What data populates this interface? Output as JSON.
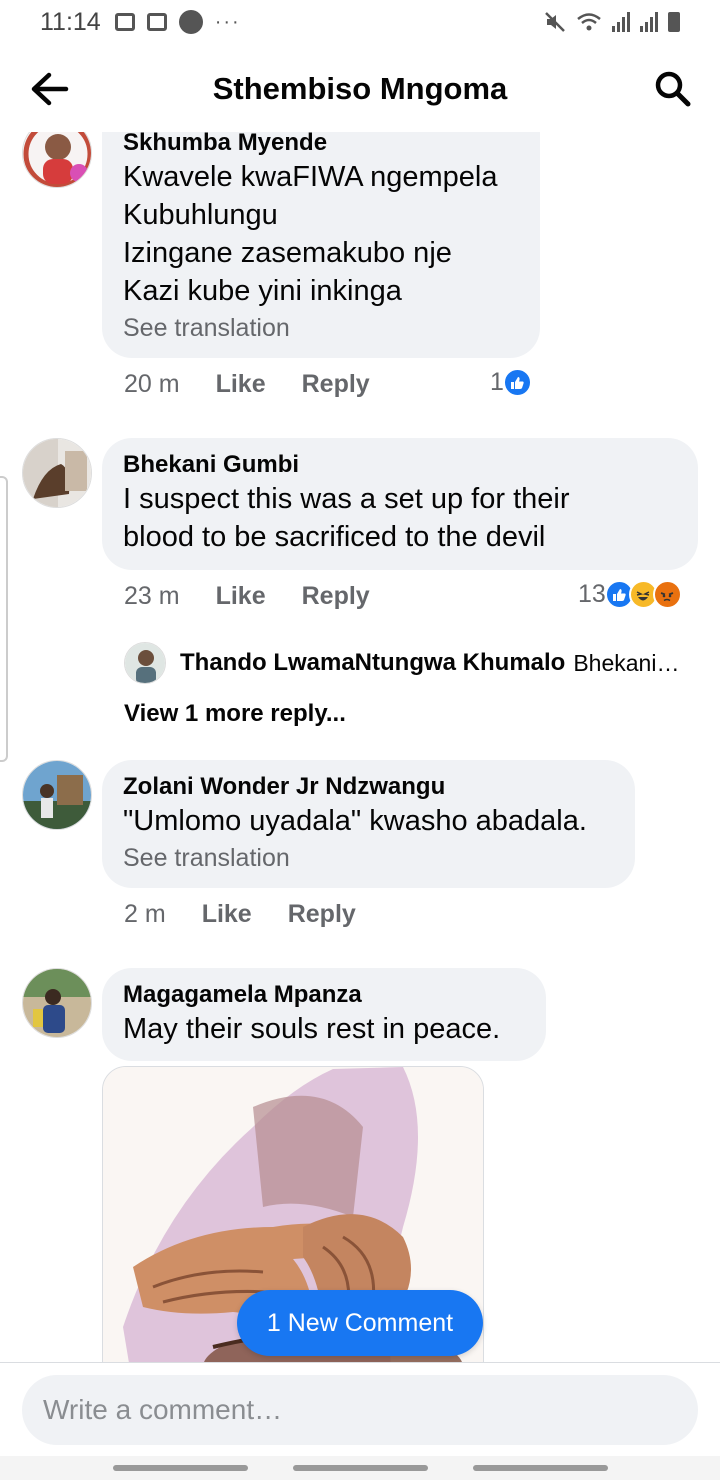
{
  "status_bar": {
    "time": "11:14",
    "more": "···"
  },
  "header": {
    "title": "Sthembiso Mngoma"
  },
  "comments": [
    {
      "name": "Skhumba Myende",
      "lines": [
        "Kwavele kwaFIWA ngempela",
        "Kubuhlungu",
        "Izingane zasemakubo nje",
        "Kazi kube yini inkinga"
      ],
      "see_translation": "See translation",
      "time": "20 m",
      "like": "Like",
      "reply": "Reply",
      "reaction_count": "1"
    },
    {
      "name": "Bhekani Gumbi",
      "lines": [
        "I suspect this was a set up for their",
        "blood to be sacrificed to the devil"
      ],
      "time": "23 m",
      "like": "Like",
      "reply": "Reply",
      "reaction_count": "13",
      "reply_preview": {
        "name": "Thando LwamaNtungwa Khumalo",
        "snippet": "Bhekani…"
      },
      "view_more": "View 1 more reply..."
    },
    {
      "name": "Zolani Wonder Jr Ndzwangu",
      "lines": [
        "\"Umlomo uyadala\" kwasho abadala."
      ],
      "see_translation": "See translation",
      "time": "2 m",
      "like": "Like",
      "reply": "Reply"
    },
    {
      "name": "Magagamela Mpanza",
      "lines": [
        "May their souls rest in peace."
      ]
    }
  ],
  "new_comment_pill": "1 New Comment",
  "composer": {
    "placeholder": "Write a comment…"
  },
  "colors": {
    "accent": "#1877f2",
    "bubble": "#f0f2f5",
    "secondary_text": "#65676b"
  }
}
